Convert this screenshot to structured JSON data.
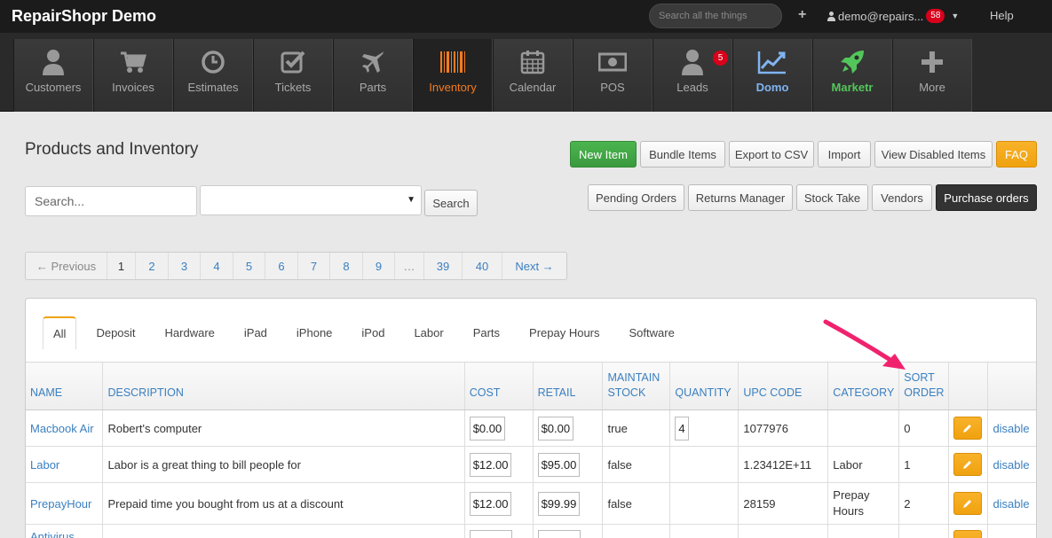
{
  "topbar": {
    "brand": "RepairShopr Demo",
    "search_placeholder": "Search all the things",
    "user_label": "demo@repairs...",
    "notification_count": "58",
    "help_label": "Help"
  },
  "nav": {
    "items": [
      {
        "label": "Customers",
        "icon": "user-icon"
      },
      {
        "label": "Invoices",
        "icon": "cart-icon"
      },
      {
        "label": "Estimates",
        "icon": "clock-icon"
      },
      {
        "label": "Tickets",
        "icon": "checkbox-icon"
      },
      {
        "label": "Parts",
        "icon": "plane-icon"
      },
      {
        "label": "Inventory",
        "icon": "barcode-icon"
      },
      {
        "label": "Calendar",
        "icon": "calendar-icon"
      },
      {
        "label": "POS",
        "icon": "money-icon"
      },
      {
        "label": "Leads",
        "icon": "user-icon",
        "badge": "5"
      },
      {
        "label": "Domo",
        "icon": "chart-line-icon"
      },
      {
        "label": "Marketr",
        "icon": "rocket-icon"
      },
      {
        "label": "More",
        "icon": "plus-icon"
      }
    ],
    "active_color": "#f47b20",
    "domo_color": "#7fb4f0",
    "marketr_color": "#52c65a"
  },
  "page": {
    "title": "Products and Inventory",
    "buttons_row1": {
      "new_item": "New Item",
      "bundle_items": "Bundle Items",
      "export_csv": "Export to CSV",
      "import": "Import",
      "view_disabled": "View Disabled Items",
      "faq": "FAQ"
    },
    "buttons_row2": {
      "pending_orders": "Pending Orders",
      "returns_manager": "Returns Manager",
      "stock_take": "Stock Take",
      "vendors": "Vendors",
      "purchase_orders": "Purchase orders"
    },
    "search_placeholder": "Search...",
    "search_button": "Search"
  },
  "pagination": {
    "previous": "← Previous",
    "pages": [
      "1",
      "2",
      "3",
      "4",
      "5",
      "6",
      "7",
      "8",
      "9",
      "…",
      "39",
      "40"
    ],
    "next": "Next →"
  },
  "tabs": [
    "All",
    "Deposit",
    "Hardware",
    "iPad",
    "iPhone",
    "iPod",
    "Labor",
    "Parts",
    "Prepay Hours",
    "Software"
  ],
  "table": {
    "headers": {
      "name": "NAME",
      "description": "DESCRIPTION",
      "cost": "COST",
      "retail": "RETAIL",
      "maintain_stock_1": "MAINTAIN",
      "maintain_stock_2": "STOCK",
      "quantity": "QUANTITY",
      "upc": "UPC CODE",
      "category": "CATEGORY",
      "sort_1": "SORT",
      "sort_2": "ORDER"
    },
    "disable_label": "disable",
    "rows": [
      {
        "name": "Macbook Air",
        "description": "Robert's computer",
        "cost": "$0.00",
        "retail": "$0.00",
        "maintain": "true",
        "quantity": "4",
        "upc": "1077976",
        "category": "",
        "sort": "0"
      },
      {
        "name": "Labor",
        "description": "Labor is a great thing to bill people for",
        "cost": "$12.00",
        "retail": "$95.00",
        "maintain": "false",
        "quantity": "",
        "upc": "1.23412E+11",
        "category": "Labor",
        "sort": "1"
      },
      {
        "name": "PrepayHour",
        "description": "Prepaid time you bought from us at a discount",
        "cost": "$12.00",
        "retail": "$99.99",
        "maintain": "false",
        "quantity": "",
        "upc": "28159",
        "category_1": "Prepay",
        "category_2": "Hours",
        "sort": "2"
      },
      {
        "name": "Antivirus",
        "description": "",
        "cost": "",
        "retail": "",
        "maintain": "",
        "quantity": "",
        "upc": "",
        "category": "",
        "sort": ""
      }
    ]
  },
  "colors": {
    "link": "#3a7fc0",
    "green_button": "#3a9a3e",
    "orange_button": "#f0a20f",
    "annotation_arrow": "#f0226e"
  }
}
